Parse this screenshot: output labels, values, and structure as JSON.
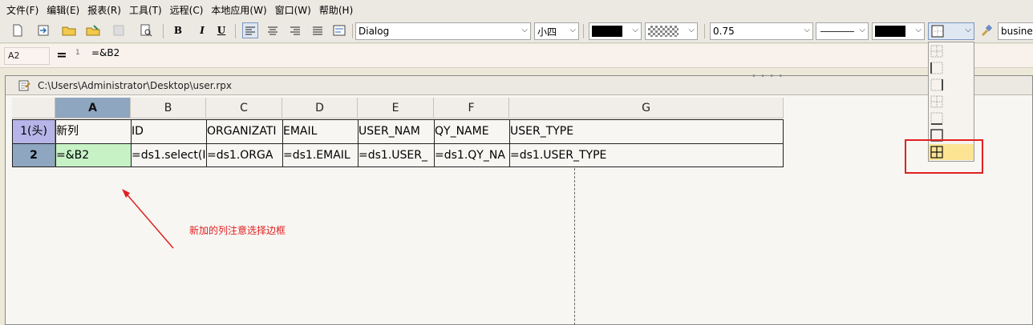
{
  "menu": [
    "文件(F)",
    "编辑(E)",
    "报表(R)",
    "工具(T)",
    "远程(C)",
    "本地应用(W)",
    "窗口(W)",
    "帮助(H)"
  ],
  "toolbar": {
    "bold": "B",
    "italic": "I",
    "underline": "U",
    "font_family": "Dialog",
    "font_size": "小四",
    "line_width": "0.75",
    "business_text": "busine",
    "fore_color": "#000000",
    "back_color": "#000000"
  },
  "formula": {
    "cell_ref": "A2",
    "equals": "=",
    "line_number": "1",
    "text": "=&B2"
  },
  "document": {
    "path": "C:\\Users\\Administrator\\Desktop\\user.rpx"
  },
  "grid": {
    "columns": [
      "A",
      "B",
      "C",
      "D",
      "E",
      "F",
      "G"
    ],
    "rows": [
      {
        "label": "1(头)",
        "cells": [
          "新列",
          "ID",
          "ORGANIZATI",
          "EMAIL",
          "USER_NAM",
          "QY_NAME",
          "USER_TYPE"
        ]
      },
      {
        "label": "2",
        "cells": [
          "=&B2",
          "=ds1.select(I",
          "=ds1.ORGA",
          "=ds1.EMAIL",
          "=ds1.USER_",
          "=ds1.QY_NA",
          "=ds1.USER_TYPE"
        ]
      }
    ]
  },
  "annotation": "新加的列注意选择边框",
  "border_options": [
    "no-border",
    "left-border",
    "right-border",
    "top-bottom-border",
    "bottom-border",
    "outer-border",
    "all-borders"
  ],
  "colors": {
    "selected_header": "#8ea6bf",
    "row_header_1": "#b6b4e8",
    "row_header_2": "#8ea6bf",
    "selected_cell": "#c6f2c6",
    "highlight": "#fde494",
    "callout": "#e02020"
  }
}
